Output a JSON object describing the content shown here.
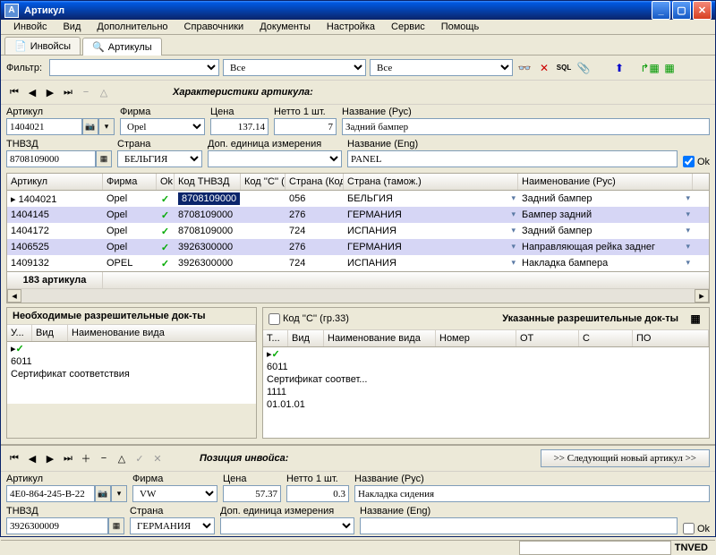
{
  "title": "Артикул",
  "menu": [
    "Инвойс",
    "Вид",
    "Дополнительно",
    "Справочники",
    "Документы",
    "Настройка",
    "Сервис",
    "Помощь"
  ],
  "tabs": {
    "invoices": "Инвойсы",
    "articles": "Артикулы"
  },
  "filter": {
    "label": "Фильтр:",
    "dd2_value": "Все",
    "dd3_value": "Все"
  },
  "section_title": "Характеристики артикула:",
  "top_form": {
    "artikul_label": "Артикул",
    "artikul": "1404021",
    "firma_label": "Фирма",
    "firma": "Opel",
    "tsena_label": "Цена",
    "tsena": "137.14",
    "netto_label": "Нетто 1 шт.",
    "netto": "7",
    "naz_rus_label": "Название (Рус)",
    "naz_rus": "Задний бампер",
    "tnvzd_label": "ТНВЗД",
    "tnvzd": "8708109000",
    "strana_label": "Страна",
    "strana": "БЕЛЬГИЯ",
    "dop_label": "Доп. единица измерения",
    "naz_eng_label": "Название (Eng)",
    "naz_eng": "PANEL",
    "ok_label": "Ok"
  },
  "grid": {
    "cols": [
      "Артикул",
      "Фирма",
      "Ok",
      "Код ТНВЗД",
      "Код ''С'' (г...",
      "Страна (Код)",
      "Страна (тамож.)",
      "Наименование (Рус)"
    ],
    "widths": [
      107,
      60,
      20,
      74,
      50,
      65,
      195,
      195
    ],
    "rows": [
      {
        "a": "1404021",
        "f": "Opel",
        "t": "8708109000",
        "c": "",
        "sk": "056",
        "st": "БЕЛЬГИЯ",
        "n": "Задний бампер",
        "sel": true
      },
      {
        "a": "1404145",
        "f": "Opel",
        "t": "8708109000",
        "c": "",
        "sk": "276",
        "st": "ГЕРМАНИЯ",
        "n": "Бампер задний"
      },
      {
        "a": "1404172",
        "f": "Opel",
        "t": "8708109000",
        "c": "",
        "sk": "724",
        "st": "ИСПАНИЯ",
        "n": "Задний бампер"
      },
      {
        "a": "1406525",
        "f": "Opel",
        "t": "3926300000",
        "c": "",
        "sk": "276",
        "st": "ГЕРМАНИЯ",
        "n": "Направляющая рейка заднег"
      },
      {
        "a": "1409132",
        "f": "OPEL",
        "t": "3926300000",
        "c": "",
        "sk": "724",
        "st": "ИСПАНИЯ",
        "n": "Накладка бампера"
      }
    ],
    "footer": "183 артикула"
  },
  "panels": {
    "left_title": "Необходимые разрешительные док-ты",
    "kod_c_label": "Код ''С'' (гр.33)",
    "right_title": "Указанные разрешительные док-ты",
    "left_cols": [
      "У...",
      "Вид",
      "Наименование вида"
    ],
    "left_row": {
      "vid": "6011",
      "name": "Сертификат соответствия"
    },
    "right_cols": [
      "Т...",
      "Вид",
      "Наименование вида",
      "Номер",
      "ОТ",
      "С",
      "ПО"
    ],
    "right_row": {
      "vid": "6011",
      "name": "Сертификат соответ...",
      "nomer": "1111",
      "ot": "01.01.01"
    }
  },
  "invoice": {
    "section_title": "Позиция инвойса:",
    "next_btn": ">> Следующий новый артикул >>",
    "artikul_label": "Артикул",
    "artikul": "4E0-864-245-B-22",
    "firma_label": "Фирма",
    "firma": "VW",
    "tsena_label": "Цена",
    "tsena": "57.37",
    "netto_label": "Нетто 1 шт.",
    "netto": "0.3",
    "naz_rus_label": "Название (Рус)",
    "naz_rus": "Накладка сидения",
    "tnvzd_label": "ТНВЗД",
    "tnvzd": "3926300009",
    "strana_label": "Страна",
    "strana": "ГЕРМАНИЯ",
    "dop_label": "Доп. единица измерения",
    "naz_eng_label": "Название (Eng)",
    "ok_label": "Ok"
  },
  "status": "TNVED"
}
